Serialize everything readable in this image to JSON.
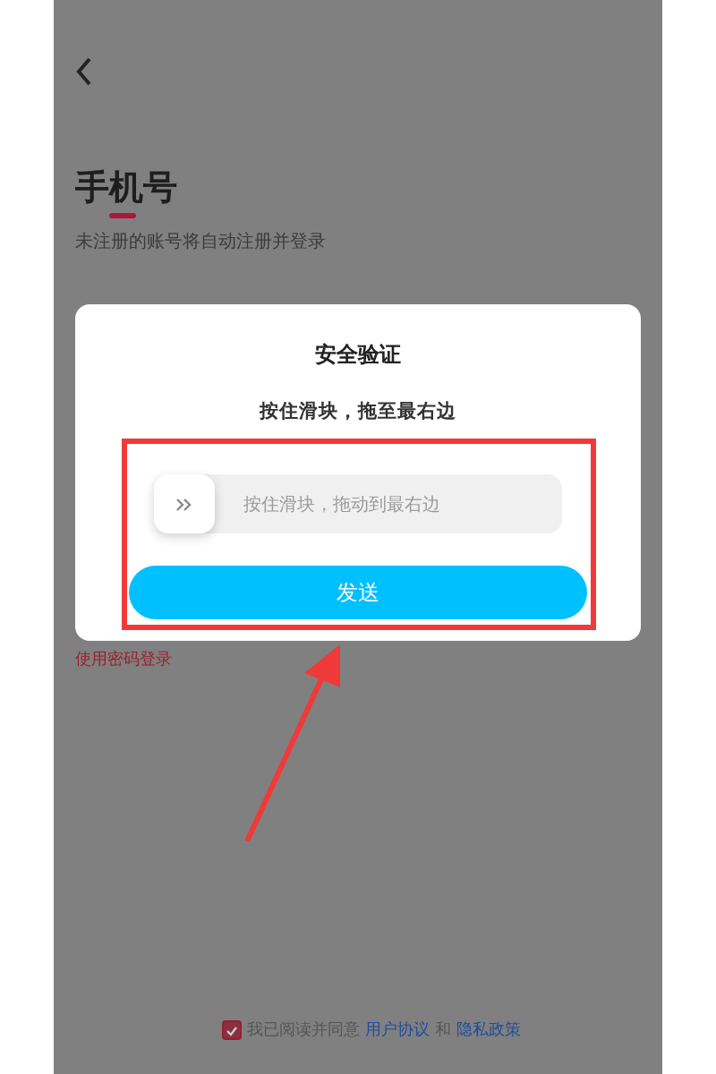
{
  "page": {
    "title": "手机号",
    "subtitle": "未注册的账号将自动注册并登录",
    "password_login_link": "使用密码登录"
  },
  "dialog": {
    "title": "安全验证",
    "instruction": "按住滑块，拖至最右边",
    "slider": {
      "placeholder": "按住滑块，拖动到最右边",
      "level": 0
    },
    "send_button": "发送"
  },
  "agreement": {
    "checked": true,
    "text": "我已阅读并同意",
    "links": [
      "用户协议",
      "隐私政策"
    ],
    "conjunction": "和"
  }
}
